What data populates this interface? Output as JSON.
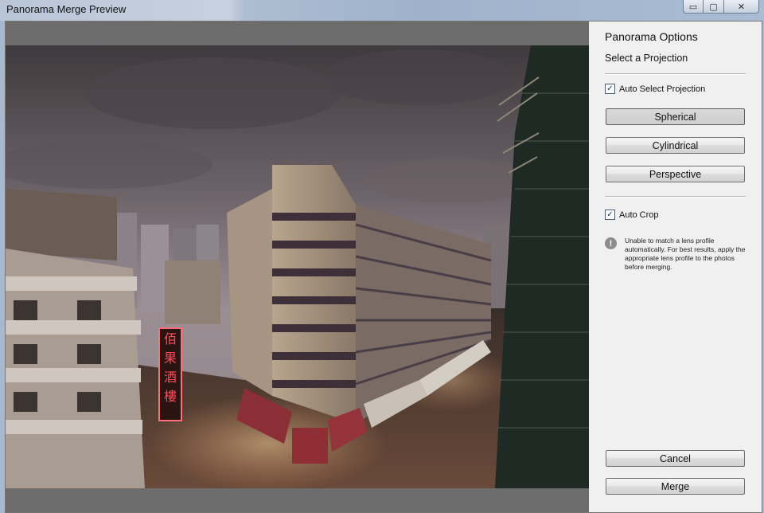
{
  "window": {
    "title": "Panorama Merge Preview",
    "controls": {
      "minimize": "▭",
      "maximize": "▢",
      "close": "✕"
    }
  },
  "panel": {
    "heading": "Panorama Options",
    "subheading": "Select a Projection",
    "auto_select_projection": {
      "label": "Auto Select Projection",
      "checked": true,
      "mark": "✓"
    },
    "projections": [
      {
        "label": "Spherical",
        "selected": true
      },
      {
        "label": "Cylindrical",
        "selected": false
      },
      {
        "label": "Perspective",
        "selected": false
      }
    ],
    "auto_crop": {
      "label": "Auto Crop",
      "checked": true,
      "mark": "✓"
    },
    "warning": {
      "icon": "!",
      "text": "Unable to match a lens profile automatically. For best results, apply the appropriate lens profile to the photos before merging."
    },
    "cancel_label": "Cancel",
    "merge_label": "Merge"
  },
  "preview": {
    "sign_text": "佰果酒樓"
  },
  "colors": {
    "background": "#f0f0f0",
    "preview_matte": "#6c6c6c",
    "accent_neon": "#ff4a5a"
  }
}
